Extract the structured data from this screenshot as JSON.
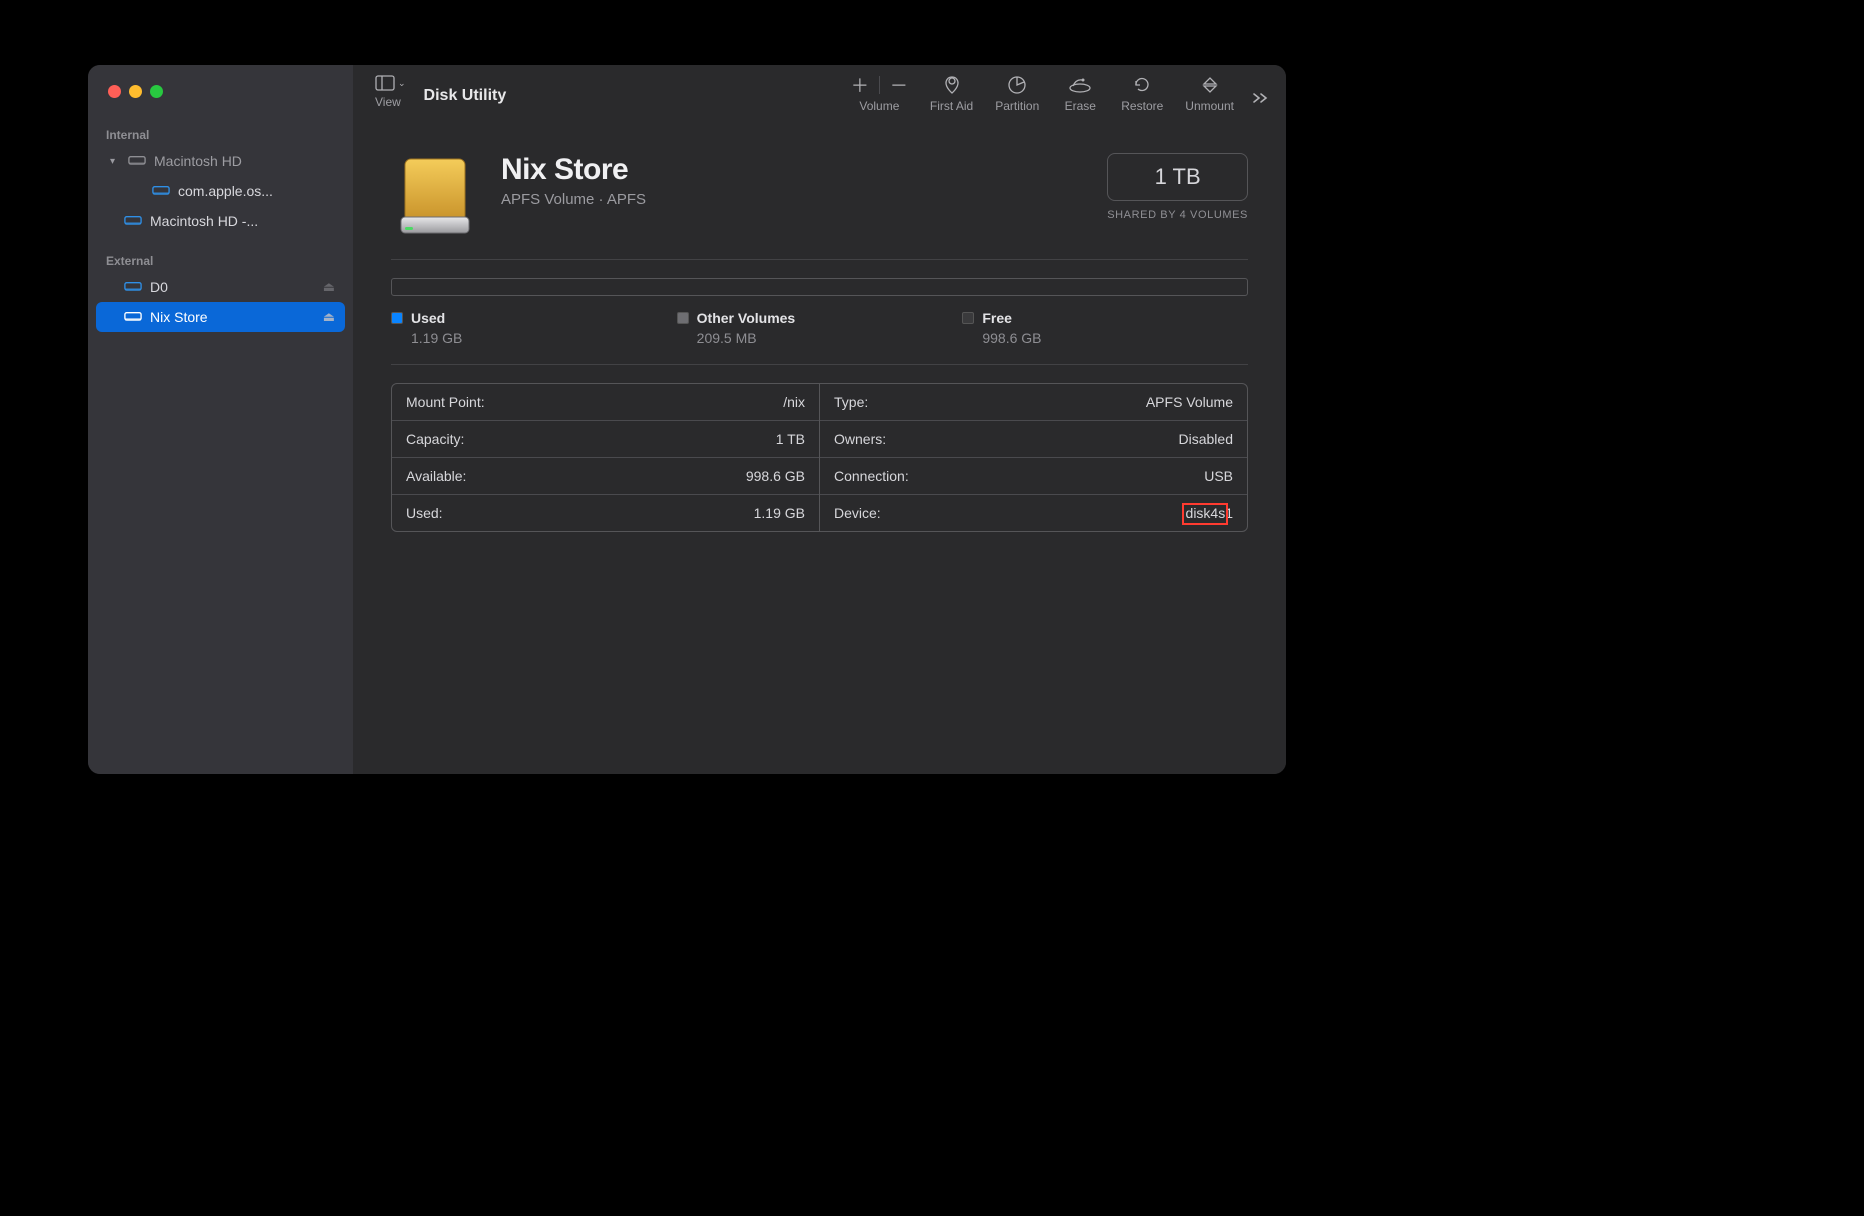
{
  "app_title": "Disk Utility",
  "toolbar": {
    "view_label": "View",
    "items": {
      "volume": "Volume",
      "first_aid": "First Aid",
      "partition": "Partition",
      "erase": "Erase",
      "restore": "Restore",
      "unmount": "Unmount"
    }
  },
  "sidebar": {
    "sections": [
      {
        "label": "Internal",
        "items": [
          {
            "label": "Macintosh HD",
            "expanded": true,
            "color": "#8e8e93"
          },
          {
            "label": "com.apple.os...",
            "indent": 2,
            "color": "#2f8fe6"
          },
          {
            "label": "Macintosh HD -...",
            "indent": 1,
            "color": "#2f8fe6"
          }
        ]
      },
      {
        "label": "External",
        "items": [
          {
            "label": "D0",
            "indent": 1,
            "color": "#2f8fe6",
            "eject": true,
            "eject_dim": true
          },
          {
            "label": "Nix Store",
            "indent": 1,
            "color": "#ffffff",
            "eject": true,
            "selected": true
          }
        ]
      }
    ]
  },
  "volume": {
    "name": "Nix Store",
    "subtitle": "APFS Volume · APFS",
    "capacity_box": "1 TB",
    "shared_label": "SHARED BY 4 VOLUMES"
  },
  "usage": {
    "used": {
      "label": "Used",
      "value": "1.19 GB",
      "color": "#0a84ff"
    },
    "other": {
      "label": "Other Volumes",
      "value": "209.5 MB",
      "color": "#6e6e72"
    },
    "free": {
      "label": "Free",
      "value": "998.6 GB",
      "color": "#3a3a3c"
    }
  },
  "info": {
    "left": [
      {
        "k": "Mount Point:",
        "v": "/nix"
      },
      {
        "k": "Capacity:",
        "v": "1 TB"
      },
      {
        "k": "Available:",
        "v": "998.6 GB"
      },
      {
        "k": "Used:",
        "v": "1.19 GB"
      }
    ],
    "right": [
      {
        "k": "Type:",
        "v": "APFS Volume"
      },
      {
        "k": "Owners:",
        "v": "Disabled"
      },
      {
        "k": "Connection:",
        "v": "USB"
      },
      {
        "k": "Device:",
        "v": "disk4s1",
        "highlight": true
      }
    ]
  }
}
